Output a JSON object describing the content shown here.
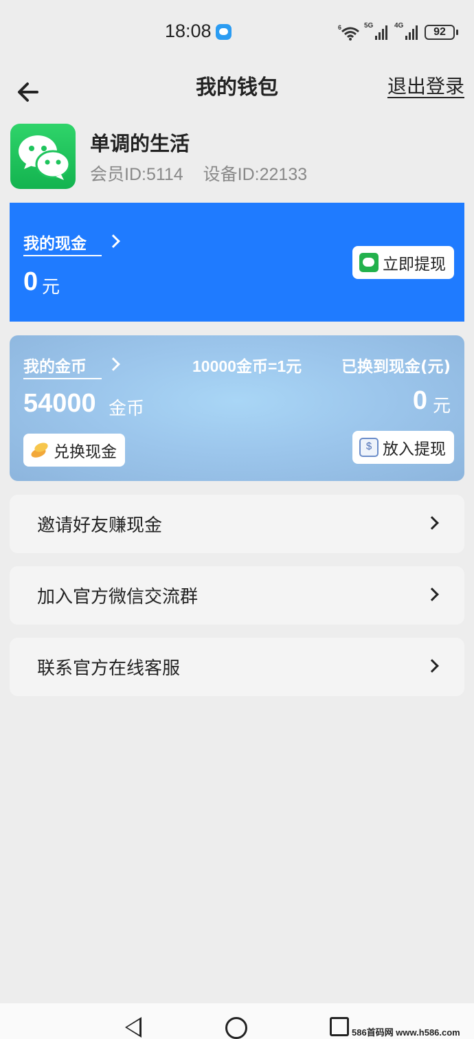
{
  "status_bar": {
    "time": "18:08",
    "signal1_tag": "5G",
    "signal2_tag": "4G",
    "battery": "92"
  },
  "header": {
    "title": "我的钱包",
    "logout": "退出登录"
  },
  "profile": {
    "name": "单调的生活",
    "member_id": "会员ID:5114",
    "device_id": "设备ID:22133"
  },
  "cash": {
    "title": "我的现金",
    "amount": "0",
    "unit": "元",
    "withdraw_button": "立即提现"
  },
  "coins": {
    "title": "我的金币",
    "rate": "10000金币=1元",
    "amount": "54000",
    "unit": "金币",
    "exchange_button": "兑换现金",
    "exchanged_label": "已换到现金(元)",
    "exchanged_amount": "0",
    "exchanged_unit": "元",
    "deposit_button": "放入提现"
  },
  "menu": {
    "items": [
      {
        "label": "邀请好友赚现金"
      },
      {
        "label": "加入官方微信交流群"
      },
      {
        "label": "联系官方在线客服"
      }
    ]
  },
  "watermark": "586首码网 www.h586.com",
  "colors": {
    "cash_card": "#1f7bff",
    "coin_card": "#9cc6ec",
    "page_bg": "#ededed",
    "wechat_green": "#1ec45c"
  }
}
